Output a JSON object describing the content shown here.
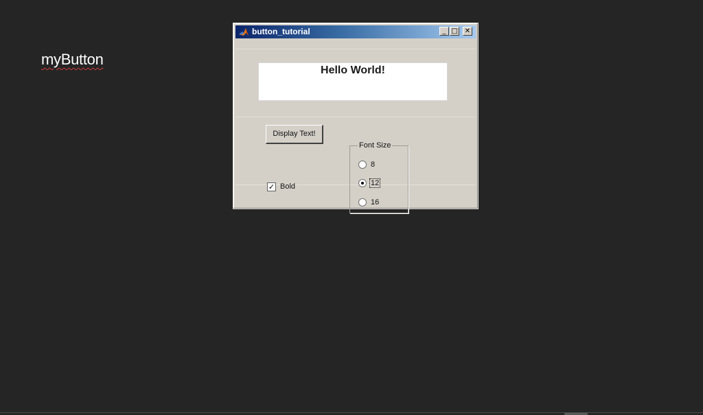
{
  "page": {
    "label": "myButton"
  },
  "window": {
    "title": "button_tutorial",
    "controls": {
      "minimize": "_",
      "maximize": "□",
      "close": "✕"
    },
    "display": {
      "text": "Hello World!"
    },
    "display_button": {
      "label": "Display Text!"
    },
    "bold_checkbox": {
      "label": "Bold",
      "checked": true,
      "mark": "✓"
    },
    "font_size_group": {
      "title": "Font Size",
      "options": [
        {
          "label": "8",
          "selected": false
        },
        {
          "label": "12",
          "selected": true
        },
        {
          "label": "16",
          "selected": false
        }
      ]
    }
  },
  "colors": {
    "desktop": "#252525",
    "window_face": "#d4d0c8",
    "titlebar_start": "#0a246a",
    "titlebar_end": "#a6caf0"
  },
  "icons": {
    "app": "matlab-icon"
  }
}
